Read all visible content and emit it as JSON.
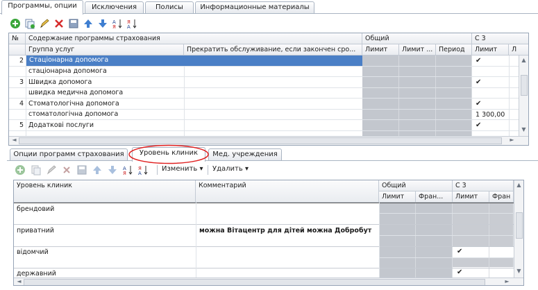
{
  "top_tabs": [
    "Программы, опции",
    "Исключения",
    "Полисы",
    "Информационные материалы"
  ],
  "top_grid": {
    "headers": {
      "num": "№",
      "content": "Содержание программы страхования",
      "group": "Группа услуг",
      "stop": "Прекратить обслуживание, если закончен сро...",
      "general": "Общий",
      "limit": "Лимит",
      "limit2": "Лимит ...",
      "period": "Период",
      "c3": "С 3",
      "c3_limit": "Лимит",
      "c3_more": "Л"
    },
    "rows": [
      {
        "num": "2",
        "program": "Стаціонарна допомога",
        "group": "стаціонарна допомога",
        "check1": "✔",
        "value2": ""
      },
      {
        "num": "3",
        "program": "Швидка допомога",
        "group": "швидка медична допомога",
        "check1": "✔",
        "value2": ""
      },
      {
        "num": "4",
        "program": "Стоматологічна допомога",
        "group": "стоматологічна допомога",
        "check1": "✔",
        "value2": "1 300,00"
      },
      {
        "num": "5",
        "program": "Додаткові послуги",
        "group": "",
        "check1": "✔",
        "value2": ""
      }
    ]
  },
  "bottom_tabs": [
    "Опции программ страхования",
    "Уровень клиник",
    "Мед. учреждения"
  ],
  "bottom_toolbar": {
    "change": "Изменить",
    "delete": "Удалить"
  },
  "bottom_grid": {
    "headers": {
      "level": "Уровень клиник",
      "comment": "Комментарий",
      "general": "Общий",
      "limit": "Лимит",
      "franchise": "Фран...",
      "c3": "С 3",
      "c3_limit": "Лимит",
      "c3_franchise": "Фран"
    },
    "rows": [
      {
        "level": "брендовий",
        "comment": "",
        "check": ""
      },
      {
        "level": "приватний",
        "comment": "можна Вітацентр для дітей  можна Добробут",
        "check": ""
      },
      {
        "level": "відомчий",
        "comment": "",
        "check": "✔"
      },
      {
        "level": "державний",
        "comment": "",
        "check": "✔"
      }
    ]
  },
  "colors": {
    "selection": "#4a7fc6",
    "border": "#97a4b6",
    "gray_cell": "#c3c7ce",
    "highlight_ellipse": "#e02020"
  }
}
